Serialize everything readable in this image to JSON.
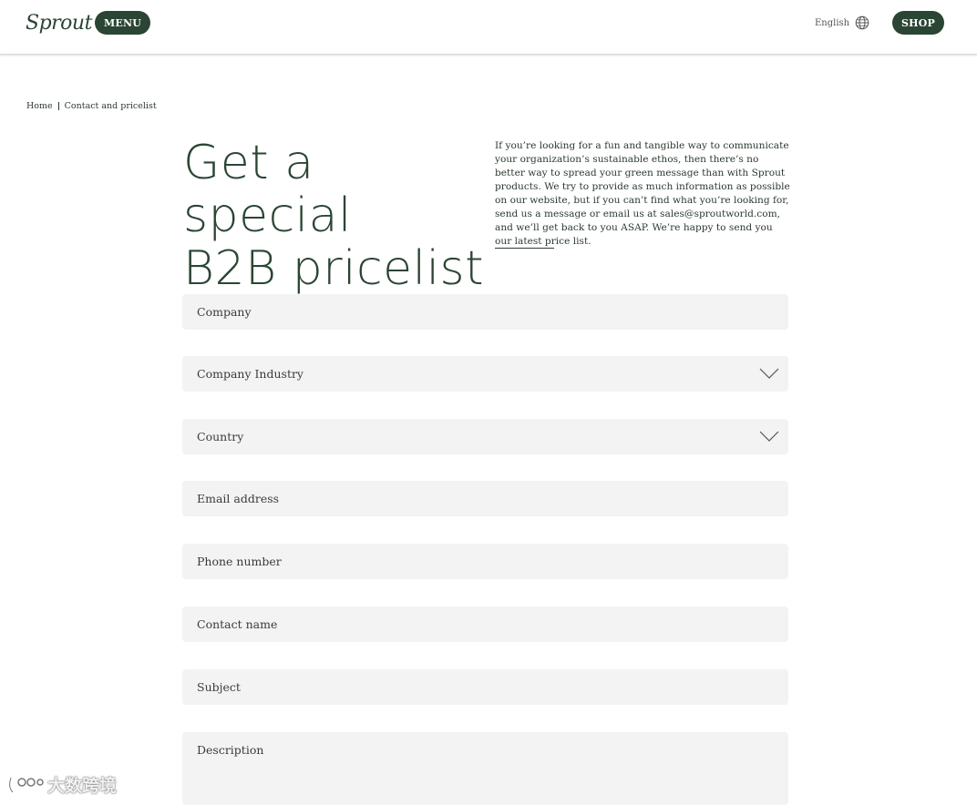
{
  "header": {
    "logo_text": "Sprout",
    "menu_label": "MENU",
    "language": "English",
    "language_icon": "globe-icon",
    "shop_label": "SHOP"
  },
  "breadcrumb": {
    "home": "Home",
    "current": "Contact and pricelist"
  },
  "hero": {
    "title_line1": "Get a special",
    "title_line2": "B2B pricelist",
    "intro": "If you’re looking for a fun and tangible way to communicate your organization’s sustainable ethos, then there’s no better way to spread your green message than with Sprout products. We try to provide as much information as possible on our website, but if you can’t find what you’re looking for, send us a message or email us at sales@sproutworld.com, and we’ll get back to you ASAP. We’re happy to send you our latest price list."
  },
  "form": {
    "company": "Company",
    "industry": "Company Industry",
    "country": "Country",
    "email": "Email address",
    "phone": "Phone number",
    "contact_name": "Contact name",
    "subject": "Subject",
    "description": "Description"
  },
  "watermark": {
    "text": "大数跨境"
  },
  "colors": {
    "brand": "#2b4534",
    "field_bg": "#f3f3f3"
  }
}
